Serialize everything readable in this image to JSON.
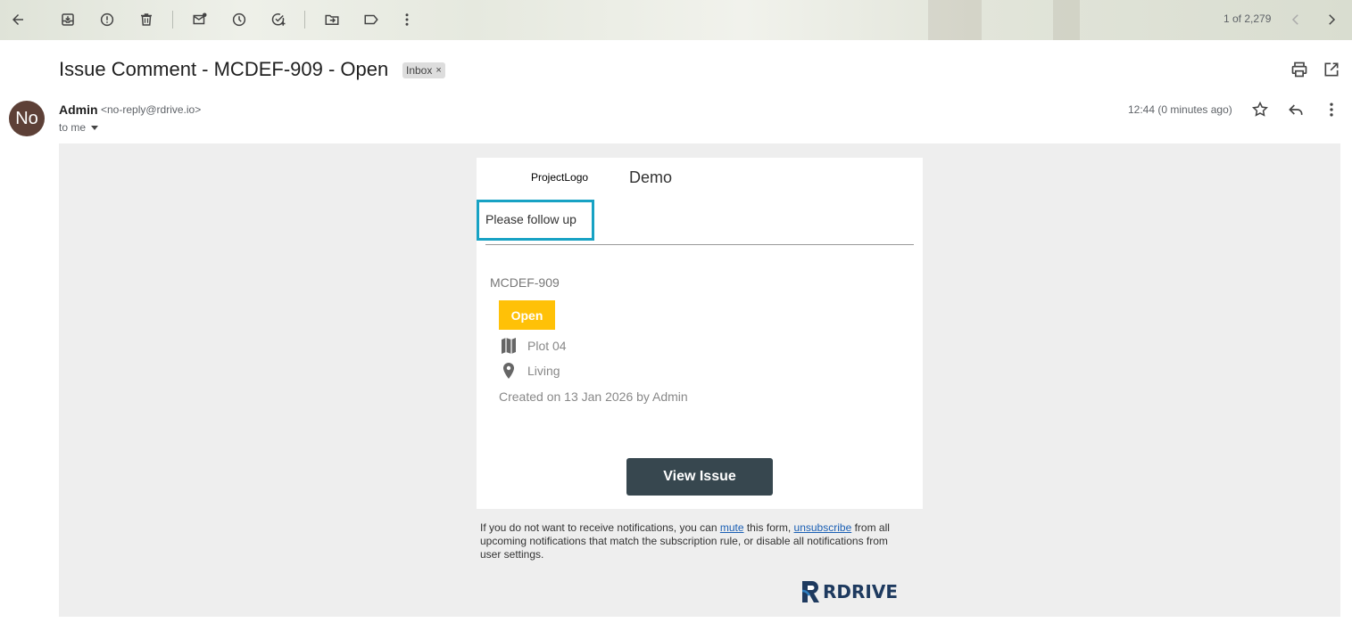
{
  "toolbar": {
    "pager_text": "1 of 2,279",
    "icons": [
      "back-icon",
      "archive-icon",
      "report-spam-icon",
      "delete-icon",
      "mark-unread-icon",
      "snooze-icon",
      "add-task-icon",
      "move-to-icon",
      "label-icon",
      "more-icon",
      "newer-icon",
      "older-icon"
    ]
  },
  "email": {
    "subject": "Issue Comment - MCDEF-909 - Open",
    "label": "Inbox",
    "label_remove": "×",
    "avatar_initials": "No",
    "sender_name": "Admin",
    "sender_email": "<no-reply@rdrive.io>",
    "to_text": "to me",
    "timestamp": "12:44 (0 minutes ago)"
  },
  "body": {
    "logo_text": "ProjectLogo",
    "project_name": "Demo",
    "comment": "Please follow up",
    "issue_id": "MCDEF-909",
    "status": "Open",
    "status_color": "#ffc107",
    "location_plot": "Plot 04",
    "location_room": "Living",
    "created": "Created on 13 Jan 2026 by Admin",
    "button_label": "View Issue",
    "button_color": "#37474f",
    "highlight_color": "#17a2c4"
  },
  "footer": {
    "part1": "If you do not want to receive notifications, you can ",
    "mute_link": "mute",
    "part2": " this form, ",
    "unsubscribe_link": "unsubscribe",
    "part3": " from all upcoming notifications that match the subscription rule, or disable all notifications from user settings.",
    "brand": "RDRIVE"
  }
}
